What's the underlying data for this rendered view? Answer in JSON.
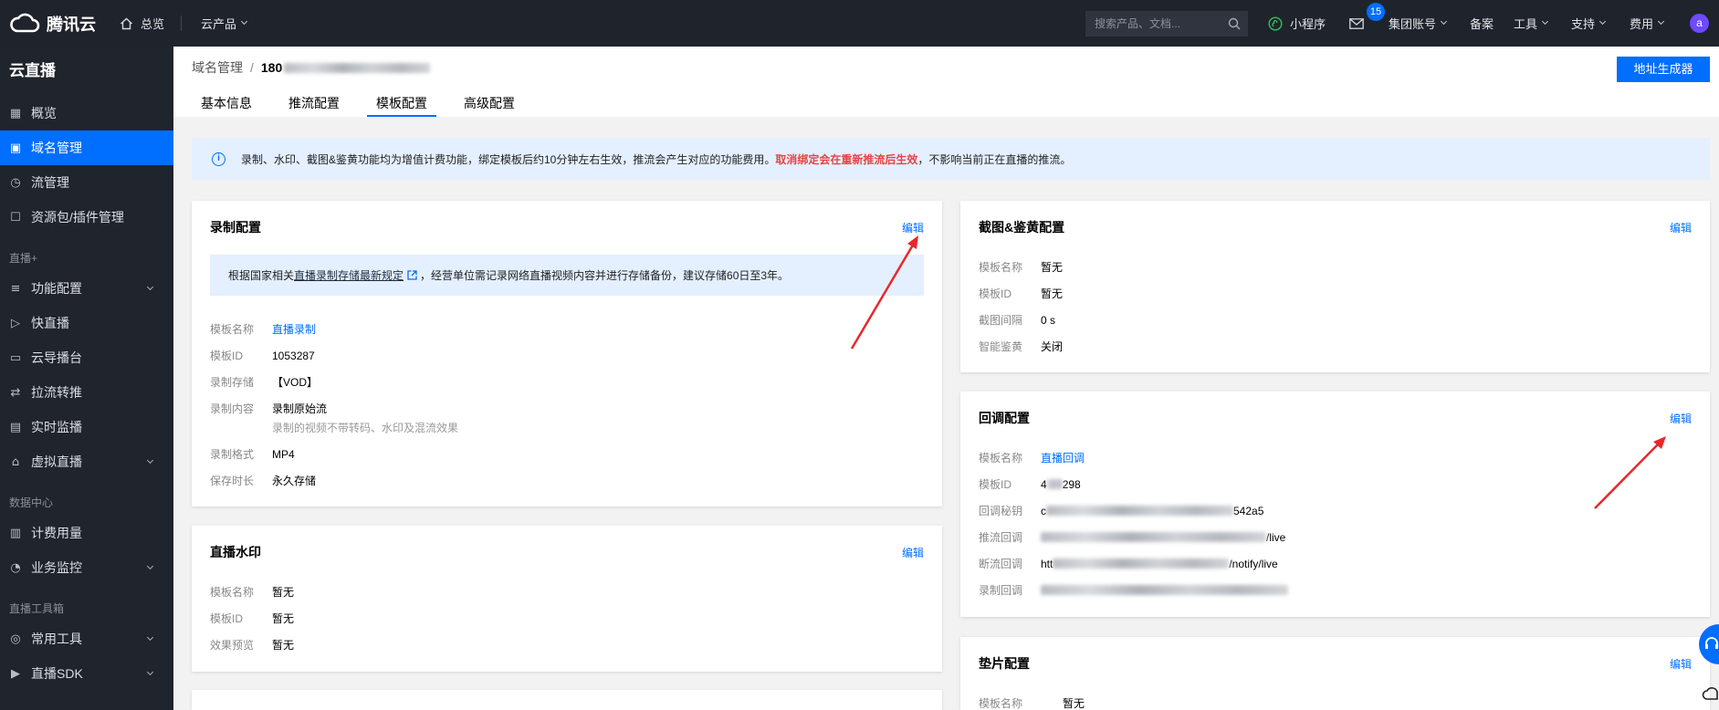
{
  "topbar": {
    "brand": "腾讯云",
    "overview": "总览",
    "products": "云产品",
    "search_placeholder": "搜索产品、文档...",
    "miniprogram": "小程序",
    "mail_badge": "15",
    "group_account": "集团账号",
    "beian": "备案",
    "tools": "工具",
    "support": "支持",
    "billing": "费用",
    "avatar": "a"
  },
  "sidebar": {
    "title": "云直播",
    "items": [
      {
        "label": "概览",
        "icon": "overview-grid-icon"
      },
      {
        "label": "域名管理",
        "icon": "domain-icon",
        "active": true
      },
      {
        "label": "流管理",
        "icon": "stream-icon"
      },
      {
        "label": "资源包/插件管理",
        "icon": "package-icon"
      },
      {
        "label": "功能配置",
        "icon": "settings-sliders-icon",
        "expandable": true
      },
      {
        "label": "快直播",
        "icon": "fast-live-icon"
      },
      {
        "label": "云导播台",
        "icon": "director-console-icon"
      },
      {
        "label": "拉流转推",
        "icon": "relay-icon"
      },
      {
        "label": "实时监播",
        "icon": "monitor-calendar-icon"
      },
      {
        "label": "虚拟直播",
        "icon": "virtual-live-icon",
        "expandable": true
      },
      {
        "label": "计费用量",
        "icon": "bar-chart-icon"
      },
      {
        "label": "业务监控",
        "icon": "gauge-icon",
        "expandable": true
      },
      {
        "label": "常用工具",
        "icon": "tools-icon",
        "expandable": true
      },
      {
        "label": "直播SDK",
        "icon": "sdk-play-icon",
        "expandable": true
      }
    ],
    "sections": [
      "直播+",
      "数据中心",
      "直播工具箱"
    ]
  },
  "header": {
    "breadcrumb_parent": "域名管理",
    "breadcrumb_sep": "/",
    "breadcrumb_current_visible": "180",
    "tabs": [
      "基本信息",
      "推流配置",
      "模板配置",
      "高级配置"
    ],
    "active_tab": "模板配置",
    "generator_button": "地址生成器"
  },
  "notice": {
    "text_before": "录制、水印、截图&鉴黄功能均为增值计费功能，绑定模板后约10分钟左右生效，推流会产生对应的功能费用。",
    "text_highlight": "取消绑定会在重新推流后生效",
    "text_after": "，不影响当前正在直播的推流。"
  },
  "cards": {
    "recording": {
      "title": "录制配置",
      "edit": "编辑",
      "notice_before": "根据国家相关",
      "notice_link": "直播录制存储最新规定",
      "notice_after": "，经营单位需记录网络直播视频内容并进行存储备份，建议存储60日至3年。",
      "rows": [
        {
          "label": "模板名称",
          "value": "直播录制"
        },
        {
          "label": "模板ID",
          "value": "1053287"
        },
        {
          "label": "录制存储",
          "value": "【VOD】"
        },
        {
          "label": "录制内容",
          "value": "录制原始流",
          "note": "录制的视频不带转码、水印及混流效果"
        },
        {
          "label": "录制格式",
          "value": "MP4"
        },
        {
          "label": "保存时长",
          "value": "永久存储"
        }
      ]
    },
    "watermark": {
      "title": "直播水印",
      "edit": "编辑",
      "rows": [
        {
          "label": "模板名称",
          "value": "暂无"
        },
        {
          "label": "模板ID",
          "value": "暂无"
        },
        {
          "label": "效果预览",
          "value": "暂无"
        }
      ]
    },
    "snapshot": {
      "title": "截图&鉴黄配置",
      "edit": "编辑",
      "rows": [
        {
          "label": "模板名称",
          "value": "暂无"
        },
        {
          "label": "模板ID",
          "value": "暂无"
        },
        {
          "label": "截图间隔",
          "value": "0 s"
        },
        {
          "label": "智能鉴黄",
          "value": "关闭"
        }
      ]
    },
    "callback": {
      "title": "回调配置",
      "edit": "编辑",
      "rows": [
        {
          "label": "模板名称",
          "value": "直播回调"
        },
        {
          "label": "模板ID",
          "prefix": "4",
          "suffix": "298"
        },
        {
          "label": "回调秘钥",
          "prefix": "c",
          "suffix": "542a5"
        },
        {
          "label": "推流回调",
          "suffix": "/live"
        },
        {
          "label": "断流回调",
          "prefix": "htt",
          "suffix": "/notify/live"
        },
        {
          "label": "录制回调"
        }
      ]
    },
    "padding": {
      "title": "垫片配置",
      "edit": "编辑",
      "rows": [
        {
          "label": "模板名称",
          "value": "暂无"
        }
      ]
    }
  },
  "colors": {
    "primary": "#006eff",
    "warning_red": "#e54545",
    "annotation_arrow": "#e8282b",
    "avatar": "#6d4aff",
    "mini_program_green": "#2bba5a"
  }
}
